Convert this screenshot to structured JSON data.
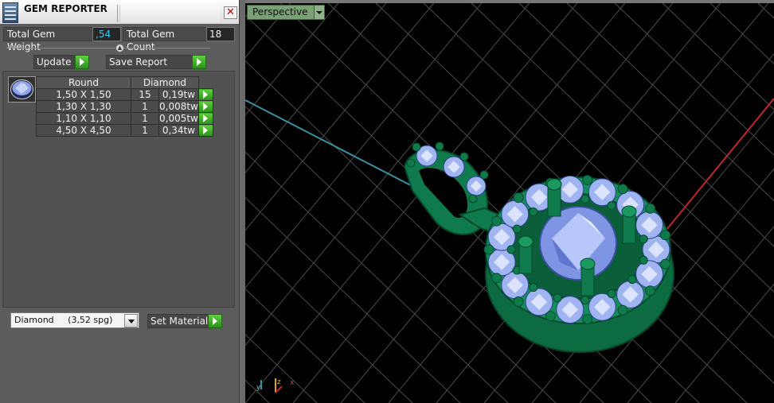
{
  "window": {
    "title": "GEM REPORTER",
    "close": "✕"
  },
  "summary": {
    "total_weight_label": "Total Gem Weight",
    "total_weight_value": ",54",
    "total_count_label": "Total Gem Count",
    "total_count_value": "18"
  },
  "toolbar": {
    "update_label": "Update",
    "save_label": "Save Report"
  },
  "table": {
    "header": {
      "shape": "Round",
      "material": "Diamond"
    },
    "rows": [
      {
        "size": "1,50 X 1,50",
        "count": "15",
        "weight": "0,19tw"
      },
      {
        "size": "1,30 X 1,30",
        "count": "1",
        "weight": "0,008tw"
      },
      {
        "size": "1,10 X 1,10",
        "count": "1",
        "weight": "0,005tw"
      },
      {
        "size": "4,50 X 4,50",
        "count": "1",
        "weight": "0,34tw"
      }
    ]
  },
  "material": {
    "selected": "Diamond     (3,52 spg)",
    "set_label": "Set Material"
  },
  "viewport": {
    "view_name": "Perspective",
    "axes": {
      "y": "y",
      "z": "z",
      "x": "x"
    }
  },
  "colors": {
    "gem": "#9fb4f0",
    "metal": "#0f7a4c",
    "accent_green": "#3fae2b",
    "x_axis": "#c0262b",
    "y_axis": "#3a8fa0"
  }
}
